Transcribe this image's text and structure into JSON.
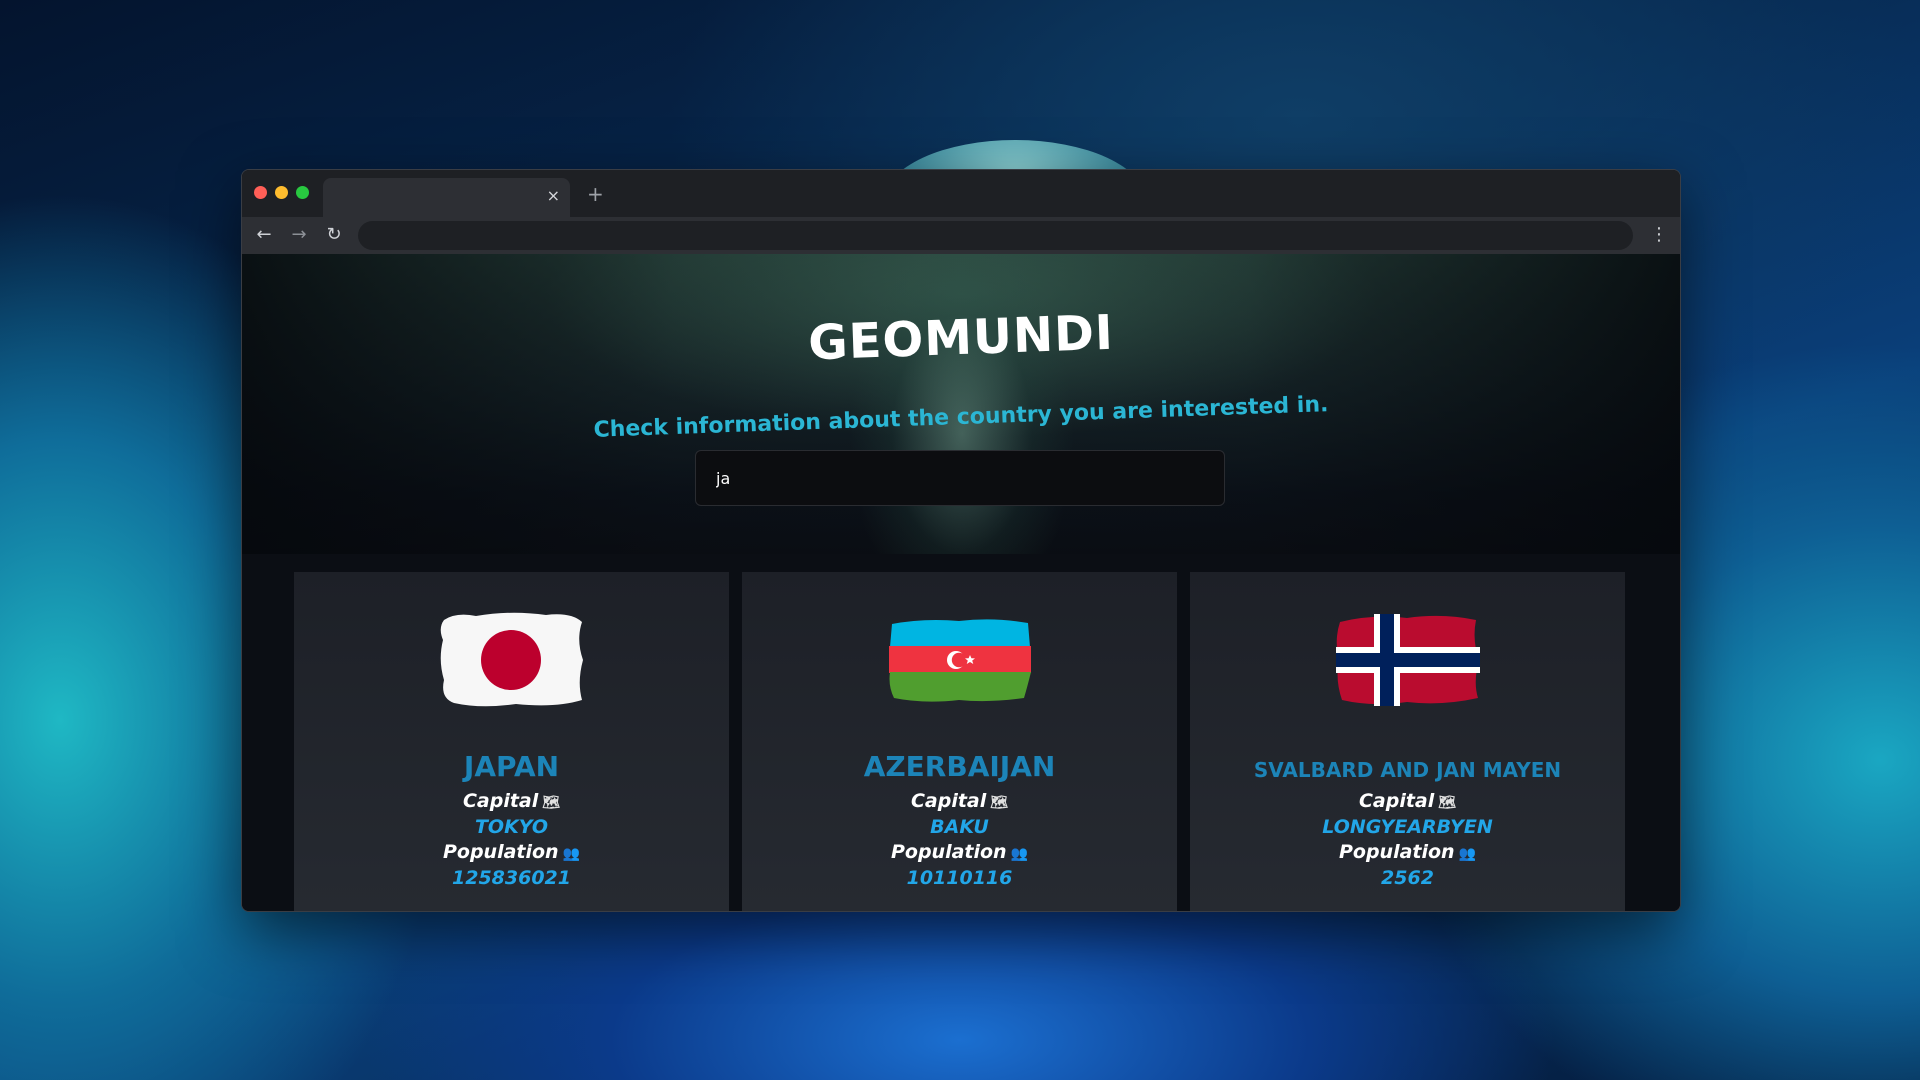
{
  "browser": {
    "tab_close_icon": "×",
    "new_tab_icon": "+",
    "back_icon": "←",
    "forward_icon": "→",
    "reload_icon": "↻",
    "menu_icon": "⋮",
    "address": ""
  },
  "app": {
    "title": "GEOMUNDI",
    "subtitle": "Check information about the country you are interested in.",
    "search_value": "ja",
    "search_placeholder": ""
  },
  "cards": [
    {
      "name": "JAPAN",
      "capital_label": "Capital",
      "capital": "TOKYO",
      "population_label": "Population",
      "population": "125836021",
      "capital_icon": "map-icon",
      "population_icon": "people-icon"
    },
    {
      "name": "AZERBAIJAN",
      "capital_label": "Capital",
      "capital": "BAKU",
      "population_label": "Population",
      "population": "10110116",
      "capital_icon": "map-icon",
      "population_icon": "people-icon"
    },
    {
      "name": "SVALBARD AND JAN MAYEN",
      "capital_label": "Capital",
      "capital": "LONGYEARBYEN",
      "population_label": "Population",
      "population": "2562",
      "capital_icon": "map-icon",
      "population_icon": "people-icon"
    }
  ],
  "colors": {
    "accent": "#2bb6d4",
    "country_name": "#1c84b8",
    "value": "#22a6e8",
    "japan_red": "#bc002d",
    "az_blue": "#00b5e2",
    "az_red": "#ef3340",
    "az_green": "#509e2f",
    "no_red": "#ba0c2f",
    "no_blue": "#00205b"
  }
}
